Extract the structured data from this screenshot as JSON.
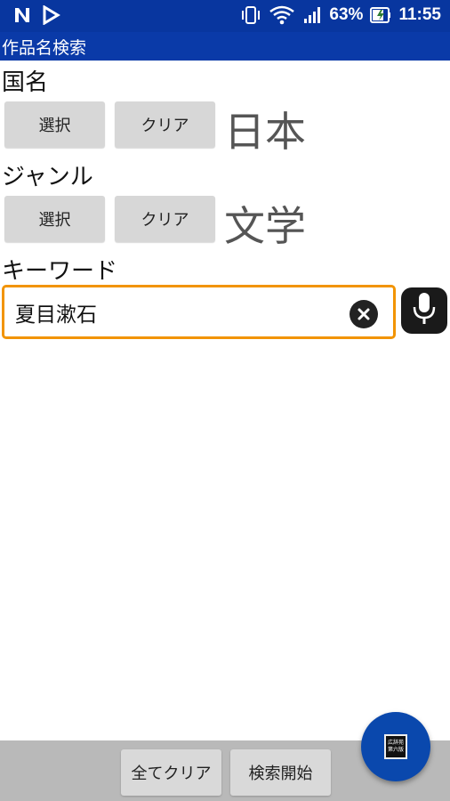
{
  "status_bar": {
    "battery": "63%",
    "time": "11:55",
    "icons": [
      "n-notification-icon",
      "play-store-icon",
      "vibrate-icon",
      "wifi-icon",
      "signal-icon",
      "battery-charging-icon"
    ]
  },
  "title": "作品名検索",
  "country": {
    "label": "国名",
    "select_label": "選択",
    "clear_label": "クリア",
    "value": "日本"
  },
  "genre": {
    "label": "ジャンル",
    "select_label": "選択",
    "clear_label": "クリア",
    "value": "文学"
  },
  "keyword": {
    "label": "キーワード",
    "value": "夏目漱石",
    "accent": "#f29400"
  },
  "bottom": {
    "clear_all_label": "全てクリア",
    "search_label": "検索開始"
  },
  "fab": {
    "text_line1": "広辞苑",
    "text_line2": "第六版",
    "color": "#0a48ad"
  },
  "colors": {
    "status_bar": "#08369f",
    "title_bar": "#0a3aa8",
    "bottom_bar": "#b9b9b9"
  }
}
